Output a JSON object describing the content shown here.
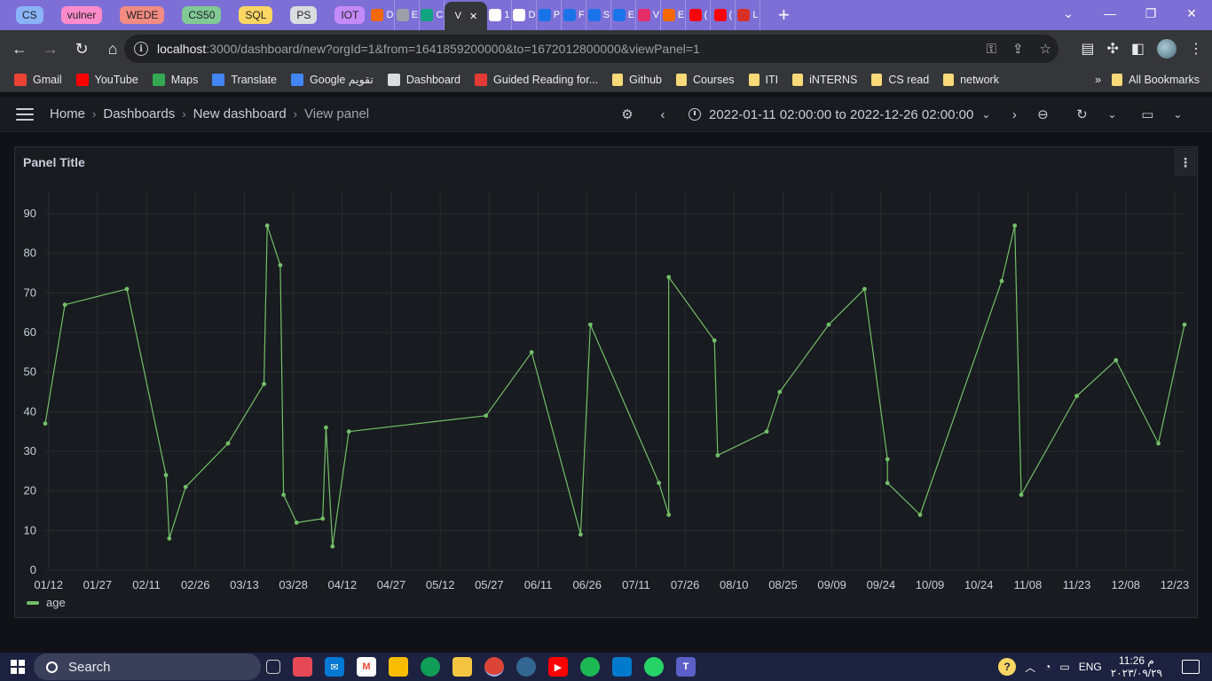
{
  "browser": {
    "tab_groups": [
      {
        "label": "CS",
        "color": "#8ab4f8"
      },
      {
        "label": "vulner",
        "color": "#ff8bcb"
      },
      {
        "label": "WEDE",
        "color": "#f28b82"
      },
      {
        "label": "CS50",
        "color": "#81c995"
      },
      {
        "label": "SQL",
        "color": "#fdd663"
      },
      {
        "label": "PS",
        "color": "#dadce0"
      },
      {
        "label": "IOT",
        "color": "#c58af9"
      }
    ],
    "tabs": [
      {
        "icon": "grafana-icon",
        "color": "#f46800",
        "text": "D"
      },
      {
        "icon": "globe-icon",
        "color": "#9aa0a6",
        "text": "E"
      },
      {
        "icon": "chatgpt-icon",
        "color": "#10a37f",
        "text": "C"
      },
      {
        "icon": "",
        "color": "",
        "text": "V",
        "active": true
      },
      {
        "icon": "codeforces-icon",
        "color": "#ffffff",
        "text": "1"
      },
      {
        "icon": "google-icon",
        "color": "#ffffff",
        "text": "D"
      },
      {
        "icon": "k-icon",
        "color": "#1a73e8",
        "text": "P"
      },
      {
        "icon": "k-icon",
        "color": "#1a73e8",
        "text": "F"
      },
      {
        "icon": "k-icon",
        "color": "#1a73e8",
        "text": "S"
      },
      {
        "icon": "k-icon",
        "color": "#1a73e8",
        "text": "E"
      },
      {
        "icon": "play-icon",
        "color": "#e52d6a",
        "text": "V"
      },
      {
        "icon": "grafana-icon",
        "color": "#f46800",
        "text": "E"
      },
      {
        "icon": "youtube-icon",
        "color": "#ff0000",
        "text": "("
      },
      {
        "icon": "youtube-icon",
        "color": "#ff0000",
        "text": "("
      },
      {
        "icon": "pdf-icon",
        "color": "#d93025",
        "text": "L"
      }
    ],
    "url_host": "localhost",
    "url_rest": ":3000/dashboard/new?orgId=1&from=1641859200000&to=1672012800000&viewPanel=1",
    "bookmarks": [
      {
        "label": "Gmail",
        "icon": "gmail-icon",
        "color": "#ea4335"
      },
      {
        "label": "YouTube",
        "icon": "youtube-icon",
        "color": "#ff0000"
      },
      {
        "label": "Maps",
        "icon": "maps-icon",
        "color": "#34a853"
      },
      {
        "label": "Translate",
        "icon": "translate-icon",
        "color": "#4285f4"
      },
      {
        "label": "Google تقويم",
        "icon": "calendar-icon",
        "color": "#4285f4"
      },
      {
        "label": "Dashboard",
        "icon": "dashboard-icon",
        "color": "#dadce0"
      },
      {
        "label": "Guided Reading for...",
        "icon": "s-icon",
        "color": "#e53935"
      },
      {
        "label": "Github",
        "icon": "folder-icon",
        "color": "#f9d978"
      },
      {
        "label": "Courses",
        "icon": "folder-icon",
        "color": "#f9d978"
      },
      {
        "label": "ITI",
        "icon": "folder-icon",
        "color": "#f9d978"
      },
      {
        "label": "iNTERNS",
        "icon": "folder-icon",
        "color": "#f9d978"
      },
      {
        "label": "CS read",
        "icon": "folder-icon",
        "color": "#f9d978"
      },
      {
        "label": "network",
        "icon": "folder-icon",
        "color": "#f9d978"
      }
    ],
    "bookmarks_overflow": "»",
    "all_bookmarks": "All Bookmarks"
  },
  "grafana": {
    "breadcrumbs": [
      "Home",
      "Dashboards",
      "New dashboard",
      "View panel"
    ],
    "time_range": "2022-01-11 02:00:00 to 2022-12-26 02:00:00",
    "panel_title": "Panel Title",
    "accent": "#73bf69"
  },
  "chart_data": {
    "type": "line",
    "title": "Panel Title",
    "ylim": [
      0,
      95
    ],
    "y_ticks": [
      0,
      10,
      20,
      30,
      40,
      50,
      60,
      70,
      80,
      90
    ],
    "x_tick_labels": [
      "01/12",
      "01/27",
      "02/11",
      "02/26",
      "03/13",
      "03/28",
      "04/12",
      "04/27",
      "05/12",
      "05/27",
      "06/11",
      "06/26",
      "07/11",
      "07/26",
      "08/10",
      "08/25",
      "09/09",
      "09/24",
      "10/09",
      "10/24",
      "11/08",
      "11/23",
      "12/08",
      "12/23"
    ],
    "x_start": "2022-01-11",
    "x_end": "2022-12-26",
    "series": [
      {
        "name": "age",
        "color": "#73bf69",
        "points": [
          [
            "2022-01-11",
            37
          ],
          [
            "2022-01-17",
            67
          ],
          [
            "2022-02-05",
            71
          ],
          [
            "2022-02-17",
            24
          ],
          [
            "2022-02-18",
            8
          ],
          [
            "2022-02-23",
            21
          ],
          [
            "2022-03-08",
            32
          ],
          [
            "2022-03-19",
            47
          ],
          [
            "2022-03-20",
            87
          ],
          [
            "2022-03-24",
            77
          ],
          [
            "2022-03-25",
            19
          ],
          [
            "2022-03-29",
            12
          ],
          [
            "2022-04-06",
            13
          ],
          [
            "2022-04-07",
            36
          ],
          [
            "2022-04-09",
            6
          ],
          [
            "2022-04-14",
            35
          ],
          [
            "2022-05-26",
            39
          ],
          [
            "2022-06-09",
            55
          ],
          [
            "2022-06-24",
            9
          ],
          [
            "2022-06-27",
            62
          ],
          [
            "2022-07-18",
            22
          ],
          [
            "2022-07-21",
            14
          ],
          [
            "2022-07-21",
            74
          ],
          [
            "2022-08-04",
            58
          ],
          [
            "2022-08-05",
            29
          ],
          [
            "2022-08-20",
            35
          ],
          [
            "2022-08-24",
            45
          ],
          [
            "2022-09-08",
            62
          ],
          [
            "2022-09-19",
            71
          ],
          [
            "2022-09-26",
            28
          ],
          [
            "2022-09-26",
            22
          ],
          [
            "2022-10-06",
            14
          ],
          [
            "2022-10-31",
            73
          ],
          [
            "2022-11-04",
            87
          ],
          [
            "2022-11-06",
            19
          ],
          [
            "2022-11-23",
            44
          ],
          [
            "2022-12-05",
            53
          ],
          [
            "2022-12-18",
            32
          ],
          [
            "2022-12-26",
            62
          ]
        ]
      }
    ],
    "legend": "bottom-left",
    "grid": true
  },
  "taskbar": {
    "search_placeholder": "Search",
    "language": "ENG",
    "time": "11:26 م",
    "date": "٢٠٢٣/٠٩/٢٩"
  }
}
